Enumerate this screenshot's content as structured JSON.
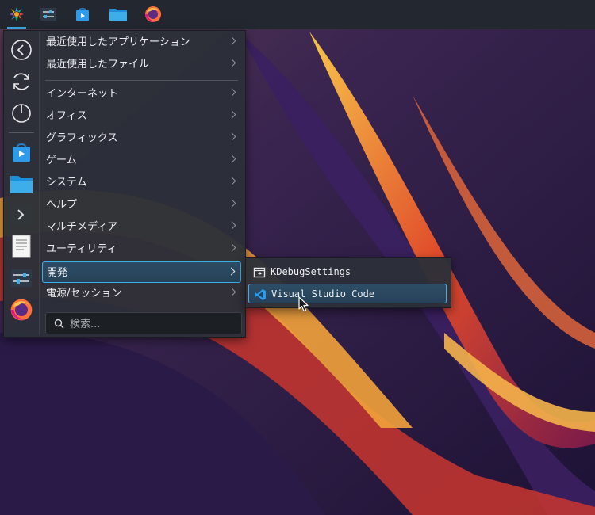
{
  "panel": {
    "tasks": [
      {
        "icon": "kde-launcher-icon",
        "active": true
      },
      {
        "icon": "system-settings-icon"
      },
      {
        "icon": "discover-store-icon"
      },
      {
        "icon": "dolphin-folder-icon"
      },
      {
        "icon": "firefox-icon"
      }
    ]
  },
  "menu": {
    "favorites": [
      {
        "icon": "back-arrow-icon"
      },
      {
        "icon": "refresh-icon"
      },
      {
        "icon": "power-icon"
      },
      {
        "icon": "discover-store-icon"
      },
      {
        "icon": "folder-icon"
      },
      {
        "icon": "terminal-icon"
      },
      {
        "icon": "text-editor-icon"
      },
      {
        "icon": "system-settings-icon"
      },
      {
        "icon": "firefox-icon"
      }
    ],
    "categories": [
      {
        "label": "最近使用したアプリケーション"
      },
      {
        "label": "最近使用したファイル"
      },
      {
        "label": "インターネット"
      },
      {
        "label": "オフィス"
      },
      {
        "label": "グラフィックス"
      },
      {
        "label": "ゲーム"
      },
      {
        "label": "システム"
      },
      {
        "label": "ヘルプ"
      },
      {
        "label": "マルチメディア"
      },
      {
        "label": "ユーティリティ"
      },
      {
        "label": "開発",
        "selected": true
      },
      {
        "label": "電源/セッション"
      }
    ],
    "search": {
      "placeholder": "検索..."
    }
  },
  "submenu": {
    "items": [
      {
        "label": "KDebugSettings",
        "icon": "kdebugsettings-icon"
      },
      {
        "label": "Visual Studio Code",
        "icon": "vscode-icon",
        "selected": true
      }
    ]
  },
  "colors": {
    "accent": "#3daee9",
    "menu_bg": "#2c3038",
    "panel_bg": "#232730"
  }
}
